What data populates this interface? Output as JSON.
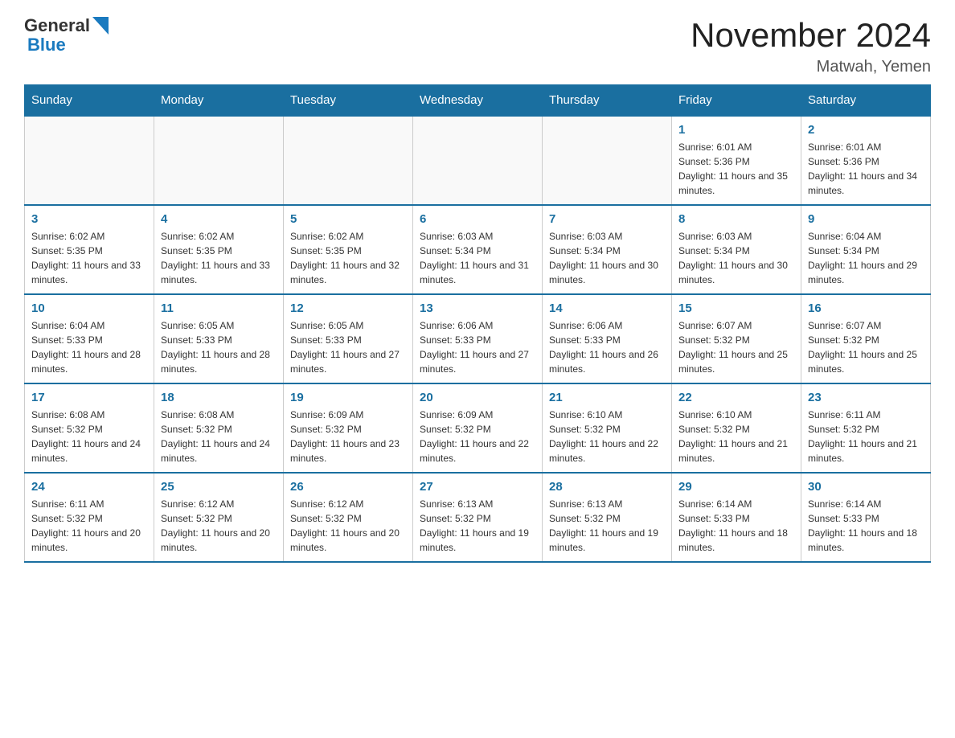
{
  "logo": {
    "text_general": "General",
    "text_blue": "Blue"
  },
  "title": "November 2024",
  "subtitle": "Matwah, Yemen",
  "days_of_week": [
    "Sunday",
    "Monday",
    "Tuesday",
    "Wednesday",
    "Thursday",
    "Friday",
    "Saturday"
  ],
  "weeks": [
    [
      {
        "day": "",
        "info": ""
      },
      {
        "day": "",
        "info": ""
      },
      {
        "day": "",
        "info": ""
      },
      {
        "day": "",
        "info": ""
      },
      {
        "day": "",
        "info": ""
      },
      {
        "day": "1",
        "info": "Sunrise: 6:01 AM\nSunset: 5:36 PM\nDaylight: 11 hours and 35 minutes."
      },
      {
        "day": "2",
        "info": "Sunrise: 6:01 AM\nSunset: 5:36 PM\nDaylight: 11 hours and 34 minutes."
      }
    ],
    [
      {
        "day": "3",
        "info": "Sunrise: 6:02 AM\nSunset: 5:35 PM\nDaylight: 11 hours and 33 minutes."
      },
      {
        "day": "4",
        "info": "Sunrise: 6:02 AM\nSunset: 5:35 PM\nDaylight: 11 hours and 33 minutes."
      },
      {
        "day": "5",
        "info": "Sunrise: 6:02 AM\nSunset: 5:35 PM\nDaylight: 11 hours and 32 minutes."
      },
      {
        "day": "6",
        "info": "Sunrise: 6:03 AM\nSunset: 5:34 PM\nDaylight: 11 hours and 31 minutes."
      },
      {
        "day": "7",
        "info": "Sunrise: 6:03 AM\nSunset: 5:34 PM\nDaylight: 11 hours and 30 minutes."
      },
      {
        "day": "8",
        "info": "Sunrise: 6:03 AM\nSunset: 5:34 PM\nDaylight: 11 hours and 30 minutes."
      },
      {
        "day": "9",
        "info": "Sunrise: 6:04 AM\nSunset: 5:34 PM\nDaylight: 11 hours and 29 minutes."
      }
    ],
    [
      {
        "day": "10",
        "info": "Sunrise: 6:04 AM\nSunset: 5:33 PM\nDaylight: 11 hours and 28 minutes."
      },
      {
        "day": "11",
        "info": "Sunrise: 6:05 AM\nSunset: 5:33 PM\nDaylight: 11 hours and 28 minutes."
      },
      {
        "day": "12",
        "info": "Sunrise: 6:05 AM\nSunset: 5:33 PM\nDaylight: 11 hours and 27 minutes."
      },
      {
        "day": "13",
        "info": "Sunrise: 6:06 AM\nSunset: 5:33 PM\nDaylight: 11 hours and 27 minutes."
      },
      {
        "day": "14",
        "info": "Sunrise: 6:06 AM\nSunset: 5:33 PM\nDaylight: 11 hours and 26 minutes."
      },
      {
        "day": "15",
        "info": "Sunrise: 6:07 AM\nSunset: 5:32 PM\nDaylight: 11 hours and 25 minutes."
      },
      {
        "day": "16",
        "info": "Sunrise: 6:07 AM\nSunset: 5:32 PM\nDaylight: 11 hours and 25 minutes."
      }
    ],
    [
      {
        "day": "17",
        "info": "Sunrise: 6:08 AM\nSunset: 5:32 PM\nDaylight: 11 hours and 24 minutes."
      },
      {
        "day": "18",
        "info": "Sunrise: 6:08 AM\nSunset: 5:32 PM\nDaylight: 11 hours and 24 minutes."
      },
      {
        "day": "19",
        "info": "Sunrise: 6:09 AM\nSunset: 5:32 PM\nDaylight: 11 hours and 23 minutes."
      },
      {
        "day": "20",
        "info": "Sunrise: 6:09 AM\nSunset: 5:32 PM\nDaylight: 11 hours and 22 minutes."
      },
      {
        "day": "21",
        "info": "Sunrise: 6:10 AM\nSunset: 5:32 PM\nDaylight: 11 hours and 22 minutes."
      },
      {
        "day": "22",
        "info": "Sunrise: 6:10 AM\nSunset: 5:32 PM\nDaylight: 11 hours and 21 minutes."
      },
      {
        "day": "23",
        "info": "Sunrise: 6:11 AM\nSunset: 5:32 PM\nDaylight: 11 hours and 21 minutes."
      }
    ],
    [
      {
        "day": "24",
        "info": "Sunrise: 6:11 AM\nSunset: 5:32 PM\nDaylight: 11 hours and 20 minutes."
      },
      {
        "day": "25",
        "info": "Sunrise: 6:12 AM\nSunset: 5:32 PM\nDaylight: 11 hours and 20 minutes."
      },
      {
        "day": "26",
        "info": "Sunrise: 6:12 AM\nSunset: 5:32 PM\nDaylight: 11 hours and 20 minutes."
      },
      {
        "day": "27",
        "info": "Sunrise: 6:13 AM\nSunset: 5:32 PM\nDaylight: 11 hours and 19 minutes."
      },
      {
        "day": "28",
        "info": "Sunrise: 6:13 AM\nSunset: 5:32 PM\nDaylight: 11 hours and 19 minutes."
      },
      {
        "day": "29",
        "info": "Sunrise: 6:14 AM\nSunset: 5:33 PM\nDaylight: 11 hours and 18 minutes."
      },
      {
        "day": "30",
        "info": "Sunrise: 6:14 AM\nSunset: 5:33 PM\nDaylight: 11 hours and 18 minutes."
      }
    ]
  ]
}
